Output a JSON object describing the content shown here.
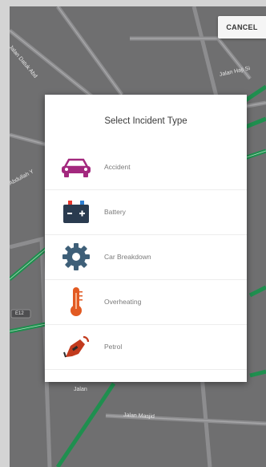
{
  "header": {
    "cancel_label": "CANCEL"
  },
  "map": {
    "labels": [
      "Jalan Datuk Abd",
      "Abdullah Y",
      "Jalan Haji Si",
      "E12",
      "Jalan Masjid",
      "Jalan"
    ]
  },
  "dialog": {
    "title": "Select Incident Type",
    "items": [
      {
        "label": "Accident",
        "icon": "car-icon"
      },
      {
        "label": "Battery",
        "icon": "battery-icon"
      },
      {
        "label": "Car Breakdown",
        "icon": "gear-icon"
      },
      {
        "label": "Overheating",
        "icon": "thermometer-icon"
      },
      {
        "label": "Petrol",
        "icon": "fuel-nozzle-icon"
      }
    ]
  },
  "colors": {
    "map_bg": "#6f6f70",
    "road_green": "#1f8f4f",
    "accident_icon": "#a3287e",
    "battery_icon": "#2a3b4f",
    "gear_icon": "#3e5f78",
    "thermo_icon": "#e25a22",
    "petrol_icon": "#c23a1d"
  }
}
